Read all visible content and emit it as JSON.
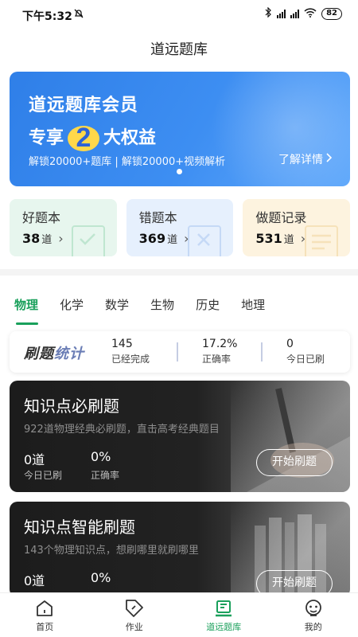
{
  "status": {
    "time": "下午5:32",
    "battery": "82"
  },
  "app_title": "道远题库",
  "banner": {
    "line1": "道远题库会员",
    "line2_pre": "专享",
    "line2_post": "大权益",
    "desc": "解锁20000+题库 | 解锁20000+视频解析",
    "more": "了解详情"
  },
  "cards": [
    {
      "label": "好题本",
      "count": "38",
      "unit": "道"
    },
    {
      "label": "错题本",
      "count": "369",
      "unit": "道"
    },
    {
      "label": "做题记录",
      "count": "531",
      "unit": "道"
    }
  ],
  "tabs": [
    "物理",
    "化学",
    "数学",
    "生物",
    "历史",
    "地理"
  ],
  "active_tab": "物理",
  "stats": {
    "logo_a": "刷题",
    "logo_b": "统计",
    "items": [
      {
        "value": "145",
        "label": "已经完成"
      },
      {
        "value": "17.2%",
        "label": "正确率"
      },
      {
        "value": "0",
        "label": "今日已刷"
      }
    ]
  },
  "panels": [
    {
      "title": "知识点必刷题",
      "subtitle": "922道物理经典必刷题，直击高考经典题目",
      "today_value": "0道",
      "today_label": "今日已刷",
      "rate_value": "0%",
      "rate_label": "正确率",
      "button": "开始刷题"
    },
    {
      "title": "知识点智能刷题",
      "subtitle": "143个物理知识点，想刷哪里就刷哪里",
      "today_value": "0道",
      "today_label": "",
      "rate_value": "0%",
      "rate_label": "",
      "button": "开始刷题"
    }
  ],
  "nav": [
    {
      "label": "首页",
      "icon": "home-icon"
    },
    {
      "label": "作业",
      "icon": "tag-icon"
    },
    {
      "label": "道远题库",
      "icon": "question-bank-icon"
    },
    {
      "label": "我的",
      "icon": "profile-icon"
    }
  ],
  "colors": {
    "accent": "#19a05b",
    "banner": "#3d8ef2"
  }
}
